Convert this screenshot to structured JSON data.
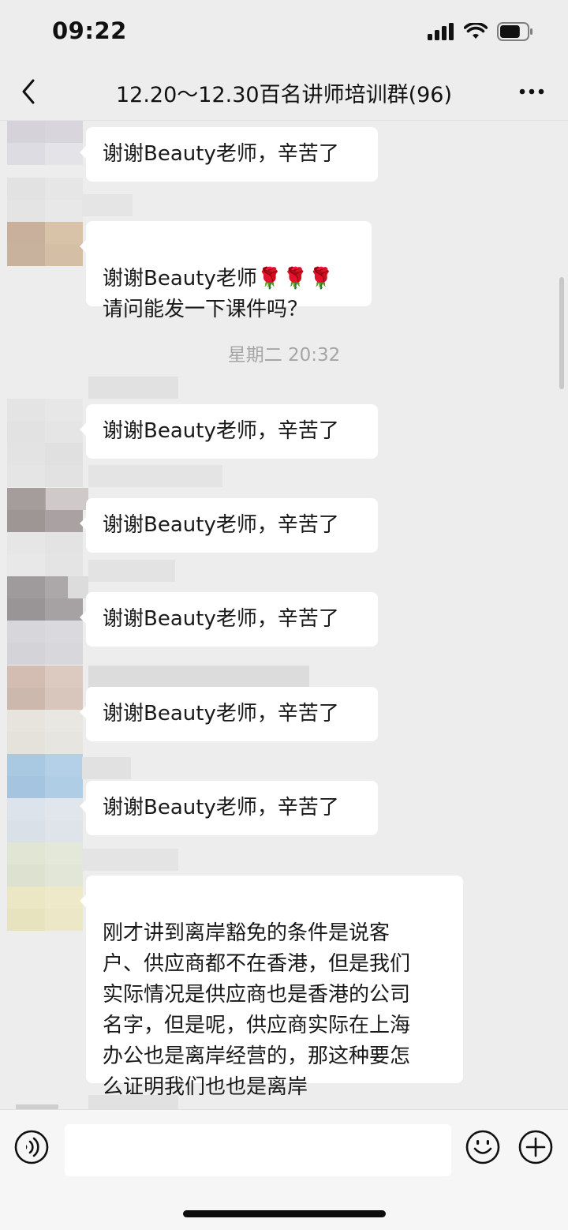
{
  "status_bar": {
    "time": "09:22",
    "battery_level": 0.75
  },
  "header": {
    "title": "12.20～12.30百名讲师培训群(96)",
    "back_icon": "chevron-left-icon",
    "more_icon": "more-dots-icon"
  },
  "messages": [
    {
      "text": "谢谢Beauty老师，辛苦了"
    },
    {
      "text": "谢谢Beauty老师🌹🌹🌹\n请问能发一下课件吗？"
    },
    {
      "text": "谢谢Beauty老师，辛苦了"
    },
    {
      "text": "谢谢Beauty老师，辛苦了"
    },
    {
      "text": "谢谢Beauty老师，辛苦了"
    },
    {
      "text": "谢谢Beauty老师，辛苦了"
    },
    {
      "text": "谢谢Beauty老师，辛苦了"
    },
    {
      "text": "刚才讲到离岸豁免的条件是说客\n户、供应商都不在香港，但是我们\n实际情况是供应商也是香港的公司\n名字，但是呢，供应商实际在上海\n办公也是离岸经营的，那这种要怎\n么证明我们也也是离岸"
    }
  ],
  "timestamp": "星期二 20:32",
  "input_bar": {
    "voice_icon": "voice-icon",
    "emoji_icon": "emoji-icon",
    "plus_icon": "plus-icon",
    "input_value": ""
  }
}
